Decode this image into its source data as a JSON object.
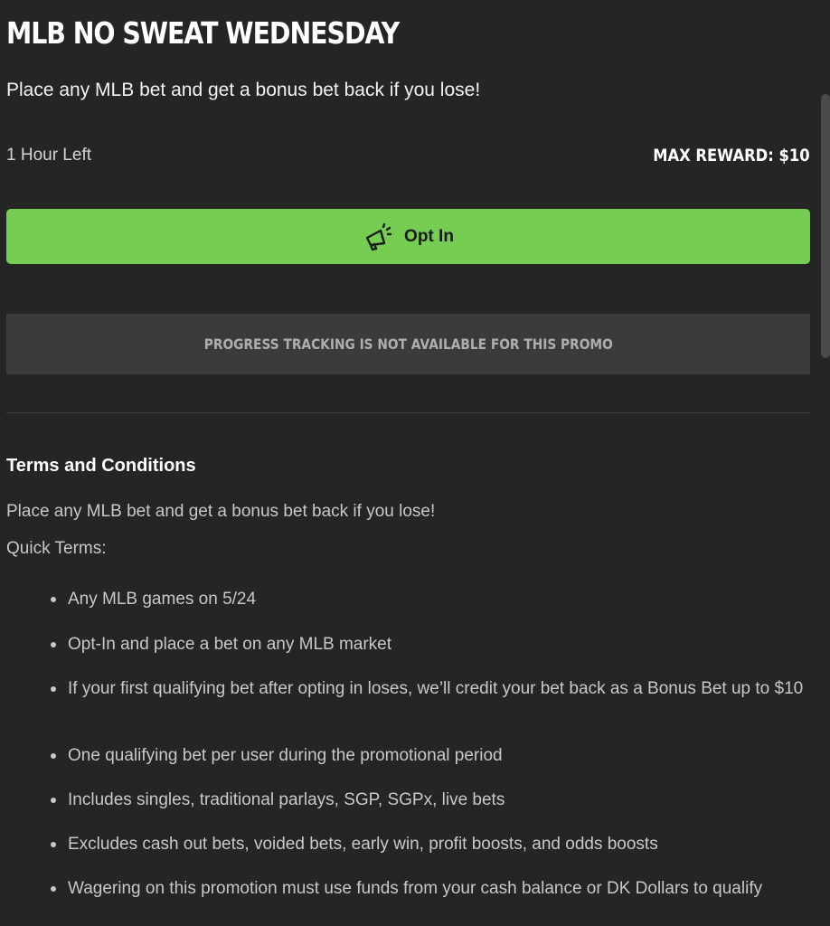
{
  "promo": {
    "title": "MLB NO SWEAT WEDNESDAY",
    "subtitle": "Place any MLB bet and get a bonus bet back if you lose!",
    "time_left": "1 Hour Left",
    "max_reward": "MAX REWARD: $10",
    "opt_in_label": "Opt In",
    "opt_in_icon": "megaphone-icon",
    "progress_message": "PROGRESS TRACKING IS NOT AVAILABLE FOR THIS PROMO"
  },
  "terms": {
    "heading": "Terms and Conditions",
    "intro": "Place any MLB bet and get a bonus bet back if you lose!",
    "quick_terms_label": "Quick Terms:",
    "items": [
      "Any MLB games on 5/24",
      "Opt-In and place a bet on any MLB market",
      "If your first qualifying bet after opting in loses, we’ll credit your bet back as a Bonus Bet up to $10",
      "One qualifying bet per user during the promotional period",
      "Includes singles, traditional parlays, SGP, SGPx, live bets",
      "Excludes cash out bets, voided bets, early win, profit boosts, and odds boosts",
      "Wagering on this promotion must use funds from your cash balance or DK Dollars to qualify"
    ]
  },
  "colors": {
    "background": "#252525",
    "accent_green": "#75cd52",
    "panel_gray": "#3b3b3b"
  }
}
